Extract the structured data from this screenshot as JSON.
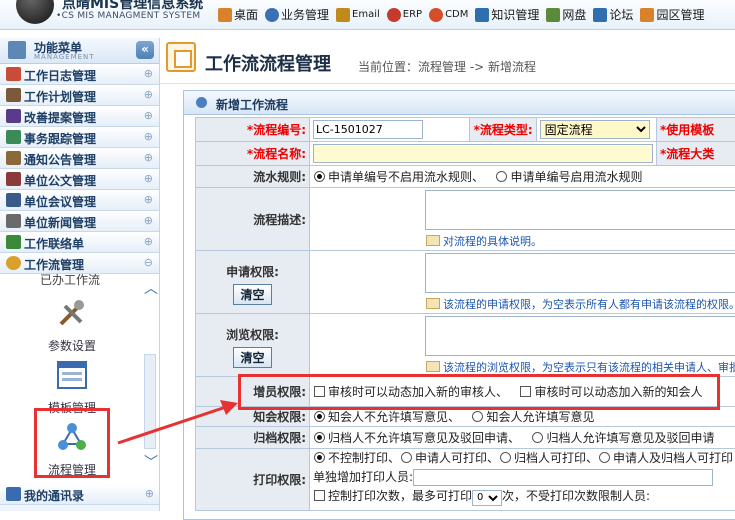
{
  "app": {
    "title": "点晴MIS管理信息系统",
    "subtitle": "CS MIS MANAGMENT SYSTEM"
  },
  "topnav": [
    {
      "label": "桌面",
      "icon": "desktop-icon",
      "color": "#d9822b"
    },
    {
      "label": "业务管理",
      "icon": "user-icon",
      "color": "#3b6fb5"
    },
    {
      "label": "Email",
      "icon": "email-icon",
      "color": "#c28a1a"
    },
    {
      "label": "ERP",
      "icon": "erp-icon",
      "color": "#c43b2d"
    },
    {
      "label": "CDM",
      "icon": "cdm-icon",
      "color": "#d44e2a"
    },
    {
      "label": "知识管理",
      "icon": "people-icon",
      "color": "#2f6fb0"
    },
    {
      "label": "网盘",
      "icon": "disk-icon",
      "color": "#5b8a3a"
    },
    {
      "label": "论坛",
      "icon": "forum-icon",
      "color": "#2f6fb0"
    },
    {
      "label": "园区管理",
      "icon": "park-icon",
      "color": "#d9822b"
    }
  ],
  "sidebar": {
    "title": "功能菜单",
    "subtitle": "MANAGEMENT",
    "collapse": "«",
    "items": [
      {
        "label": "工作日志管理",
        "icon": "calendar-icon",
        "color": "#c94b3a"
      },
      {
        "label": "工作计划管理",
        "icon": "plan-icon",
        "color": "#7a5a3a"
      },
      {
        "label": "改善提案管理",
        "icon": "book-icon",
        "color": "#5a3a8a"
      },
      {
        "label": "事务跟踪管理",
        "icon": "tracking-icon",
        "color": "#3a8a5a"
      },
      {
        "label": "通知公告管理",
        "icon": "speaker-icon",
        "color": "#8a6a3a"
      },
      {
        "label": "单位公文管理",
        "icon": "document-icon",
        "color": "#8a3a3a"
      },
      {
        "label": "单位会议管理",
        "icon": "meeting-icon",
        "color": "#3a5a8a"
      },
      {
        "label": "单位新闻管理",
        "icon": "news-icon",
        "color": "#6a6a6a"
      },
      {
        "label": "工作联络单",
        "icon": "contact-icon",
        "color": "#3a8a3a"
      },
      {
        "label": "工作流管理",
        "icon": "workflow-icon",
        "color": "#d9a02b"
      }
    ],
    "sub_cut_label": "已办工作流",
    "tools": [
      {
        "label": "参数设置",
        "icon": "tools-icon"
      },
      {
        "label": "模板管理",
        "icon": "template-icon"
      },
      {
        "label": "流程管理",
        "icon": "flow-icon"
      }
    ],
    "bottom_items": [
      {
        "label": "我的通讯录",
        "icon": "contacts-icon",
        "color": "#3a6ab0"
      }
    ]
  },
  "main": {
    "title": "工作流流程管理",
    "breadcrumb": "当前位置：流程管理 -> 新增流程"
  },
  "form": {
    "panel_title": "新增工作流程",
    "flow_no_label": "*流程编号:",
    "flow_no_value": "LC-1501027",
    "flow_type_label": "*流程类型:",
    "flow_type_value": "固定流程",
    "use_template_label": "*使用模板",
    "flow_name_label": "*流程名称:",
    "flow_name_value": "",
    "flow_category_label": "*流程大类",
    "serial_rule_label": "流水规则:",
    "serial_rule_opt1": "申请单编号不启用流水规则、",
    "serial_rule_opt2": "申请单编号启用流水规则",
    "description_label": "流程描述:",
    "description_hint": "对流程的具体说明。",
    "apply_perm_label": "申请权限:",
    "apply_perm_hint": "该流程的申请权限，为空表示所有人都有申请该流程的权限。",
    "browse_perm_label": "浏览权限:",
    "browse_perm_hint": "该流程的浏览权限，为空表示只有该流程的相关申请人、审批人、知会人",
    "clear_button": "清空",
    "add_member_label": "增员权限:",
    "add_member_opt1": "审核时可以动态加入新的审核人、",
    "add_member_opt2": "审核时可以动态加入新的知会人",
    "notify_label": "知会权限:",
    "notify_opt1": "知会人不允许填写意见、",
    "notify_opt2": "知会人允许填写意见",
    "archive_label": "归档权限:",
    "archive_opt1": "归档人不允许填写意见及驳回申请、",
    "archive_opt2": "归档人允许填写意见及驳回申请",
    "print_label": "打印权限:",
    "print_opt1": "不控制打印、",
    "print_opt2": "申请人可打印、",
    "print_opt3": "归档人可打印、",
    "print_opt4": "申请人及归档人可打印",
    "print_extra_label": "单独增加打印人员:",
    "print_count_label": "控制打印次数，最多可打印",
    "print_count_value": "0",
    "print_count_suffix": "次，不受打印次数限制人员:"
  },
  "colors": {
    "highlight": "#e83232",
    "link_hint": "#1a55b0",
    "required": "#ee0000"
  }
}
